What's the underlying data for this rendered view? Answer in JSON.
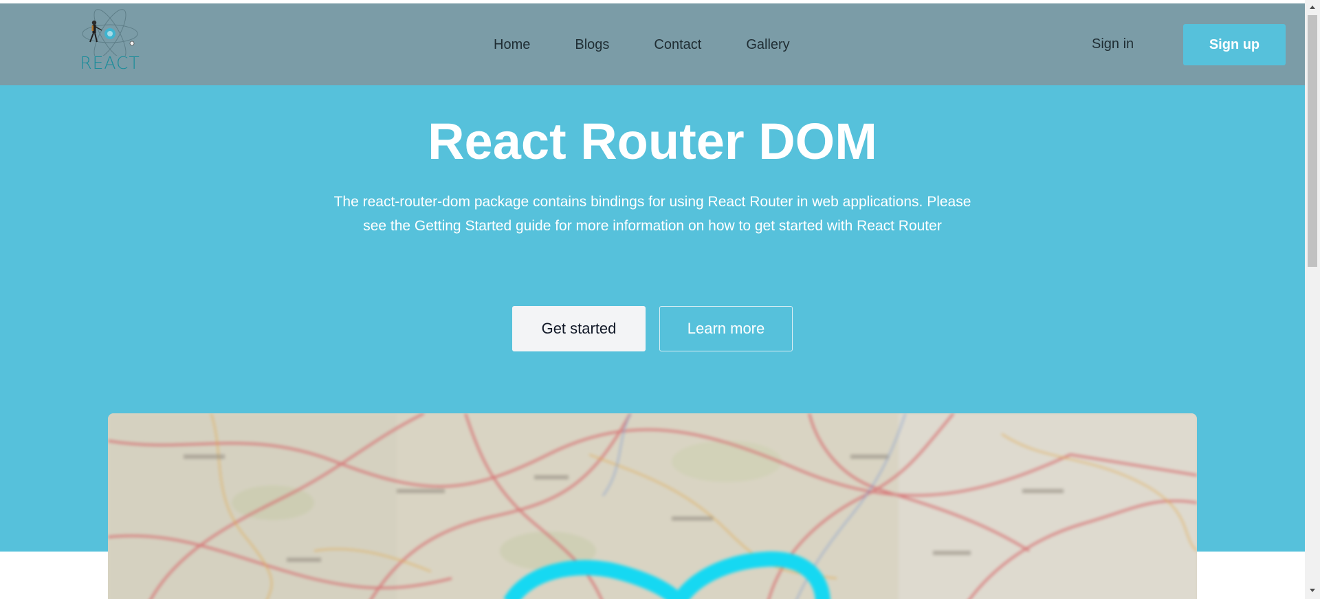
{
  "header": {
    "logo_word": "REACT",
    "nav": [
      "Home",
      "Blogs",
      "Contact",
      "Gallery"
    ],
    "sign_in": "Sign in",
    "sign_up": "Sign up"
  },
  "hero": {
    "title": "React Router DOM",
    "description": "The react-router-dom package contains bindings for using React Router in web applications. Please see the Getting Started guide for more information on how to get started with React Router",
    "primary_button": "Get started",
    "secondary_button": "Learn more"
  },
  "colors": {
    "header_bg": "#7b9ca7",
    "hero_bg": "#56c1db",
    "accent": "#56c1db",
    "logo_text": "#1a8c9a"
  },
  "icons": {
    "logo": "atom-react-logo-icon",
    "hero_image": "blurred-road-map-image"
  }
}
